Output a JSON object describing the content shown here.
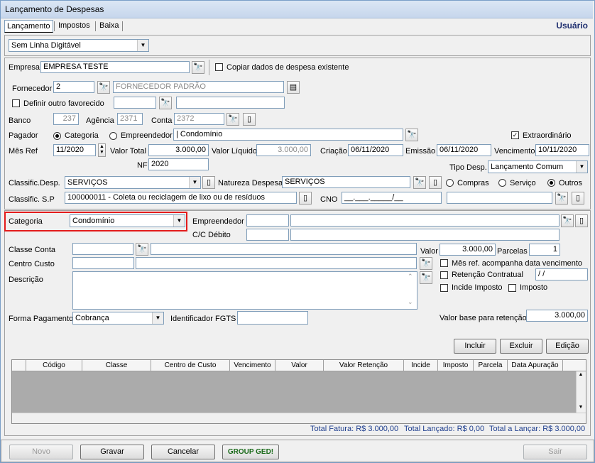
{
  "window": {
    "title": "Lançamento de Despesas"
  },
  "tabs": [
    "Lançamento",
    "Impostos",
    "Baixa"
  ],
  "user_label": "Usuário",
  "linha_digitavel": "Sem Linha Digitável",
  "empresa": {
    "label": "Empresa",
    "value": "EMPRESA TESTE",
    "copy_label": "Copiar dados de despesa existente"
  },
  "fornecedor": {
    "label": "Fornecedor",
    "code": "2",
    "name": "FORNECEDOR PADRÃO"
  },
  "favorecido": {
    "label": "Definir outro favorecido"
  },
  "banco": {
    "label": "Banco",
    "value": "237"
  },
  "agencia": {
    "label": "Agência",
    "value": "2371"
  },
  "conta": {
    "label": "Conta",
    "value": "2372"
  },
  "pagador": {
    "label": "Pagador",
    "opt1": "Categoria",
    "opt2": "Empreendedor",
    "value": "| Condomínio"
  },
  "extraordinario": "Extraordinário",
  "mes_ref": {
    "label": "Mês Ref",
    "value": "11/2020"
  },
  "valor_total": {
    "label": "Valor Total",
    "value": "3.000,00"
  },
  "valor_liquido": {
    "label": "Valor Líquido",
    "value": "3.000,00"
  },
  "criacao": {
    "label": "Criação",
    "value": "06/11/2020"
  },
  "emissao": {
    "label": "Emissão",
    "value": "06/11/2020"
  },
  "vencimento": {
    "label": "Vencimento",
    "value": "10/11/2020"
  },
  "nf": {
    "label": "NF",
    "value": "2020"
  },
  "tipo_desp": {
    "label": "Tipo Desp.",
    "value": "Lançamento Comum"
  },
  "classif_desp": {
    "label": "Classific.Desp.",
    "value": "SERVIÇOS"
  },
  "natureza": {
    "label": "Natureza Despesa",
    "value": "SERVIÇOS"
  },
  "natureza_opts": [
    "Compras",
    "Serviço",
    "Outros"
  ],
  "classif_sp": {
    "label": "Classific. S.P",
    "value": "100000011 - Coleta ou reciclagem de lixo ou de resíduos"
  },
  "cno": {
    "label": "CNO",
    "value": "__.___._____/__"
  },
  "categoria": {
    "label": "Categoria",
    "value": "Condomínio"
  },
  "empreendedor_label": "Empreendedor",
  "cc_debito_label": "C/C Débito",
  "classe_conta_label": "Classe Conta",
  "centro_custo_label": "Centro Custo",
  "descricao_label": "Descrição",
  "valor": {
    "label": "Valor",
    "value": "3.000,00"
  },
  "parcelas": {
    "label": "Parcelas",
    "value": "1"
  },
  "mes_ref_venc": "Mês ref. acompanha data vencimento",
  "retencao": {
    "label": "Retenção Contratual",
    "value": " / /"
  },
  "incide_imposto": "Incide Imposto",
  "imposto": "Imposto",
  "forma_pagamento": {
    "label": "Forma Pagamento",
    "value": "Cobrança"
  },
  "fgts_label": "Identificador FGTS",
  "valor_base": {
    "label": "Valor base para retenção",
    "value": "3.000,00"
  },
  "grid_buttons": {
    "incluir": "Incluir",
    "excluir": "Excluir",
    "edicao": "Edição"
  },
  "grid_columns": [
    "Código",
    "Classe",
    "Centro de Custo",
    "Vencimento",
    "Valor",
    "Valor Retenção",
    "Incide",
    "Imposto",
    "Parcela",
    "Data Apuração"
  ],
  "totals": {
    "fatura": "Total Fatura: R$ 3.000,00",
    "lancado": "Total Lançado: R$ 0,00",
    "a_lancar": "Total a Lançar: R$ 3.000,00"
  },
  "footer": {
    "novo": "Novo",
    "gravar": "Gravar",
    "cancelar": "Cancelar",
    "ged": "GROUP GED!",
    "sair": "Sair"
  }
}
